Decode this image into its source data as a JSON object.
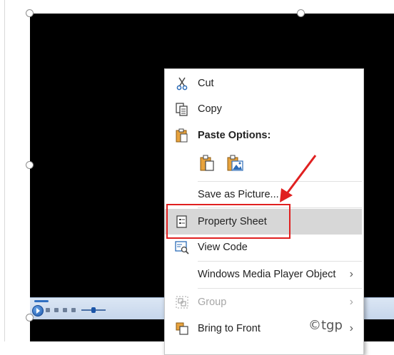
{
  "menu": {
    "cut_label": "Cut",
    "copy_label": "Copy",
    "paste_options_label": "Paste Options:",
    "save_as_picture_label": "Save as Picture...",
    "property_sheet_label": "Property Sheet",
    "view_code_label": "View Code",
    "wmp_object_label": "Windows Media Player Object",
    "group_label": "Group",
    "bring_to_front_label": "Bring to Front"
  },
  "colors": {
    "highlight": "#d7d7d7",
    "callout": "#e02020",
    "icon_orange": "#e8a33d",
    "icon_blue": "#2b6cb8"
  },
  "watermark": "©tgp"
}
